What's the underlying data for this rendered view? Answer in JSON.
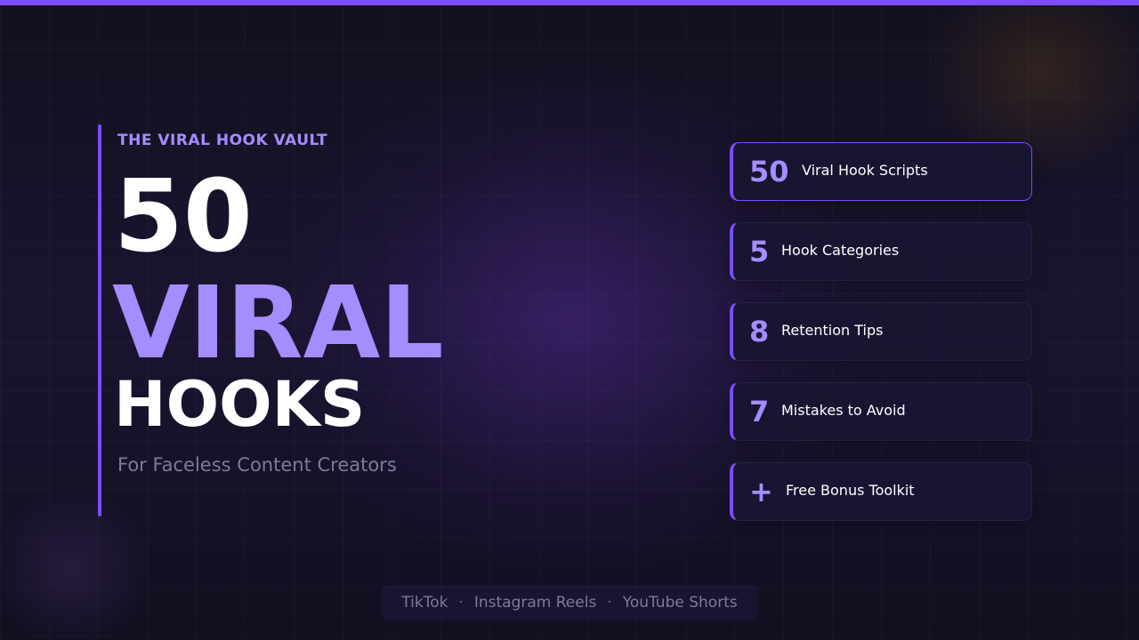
{
  "eyebrow": "THE VIRAL HOOK VAULT",
  "title": {
    "line1": "50",
    "line2": "VIRAL",
    "line3": "HOOKS"
  },
  "subtitle": "For Faceless Content Creators",
  "stats": [
    {
      "number": "50",
      "label": "Viral Hook Scripts"
    },
    {
      "number": "5",
      "label": "Hook Categories"
    },
    {
      "number": "8",
      "label": "Retention Tips"
    },
    {
      "number": "7",
      "label": "Mistakes to Avoid"
    },
    {
      "number": "+",
      "label": "Free Bonus Toolkit"
    }
  ],
  "platforms": {
    "items": [
      "TikTok",
      "Instagram Reels",
      "YouTube Shorts"
    ],
    "separator": "·"
  },
  "colors": {
    "accent": "#7c4dff",
    "accent_light": "#a58cff",
    "background": "#0f0d1c",
    "card": "#18163a",
    "muted_text": "#807a99"
  }
}
